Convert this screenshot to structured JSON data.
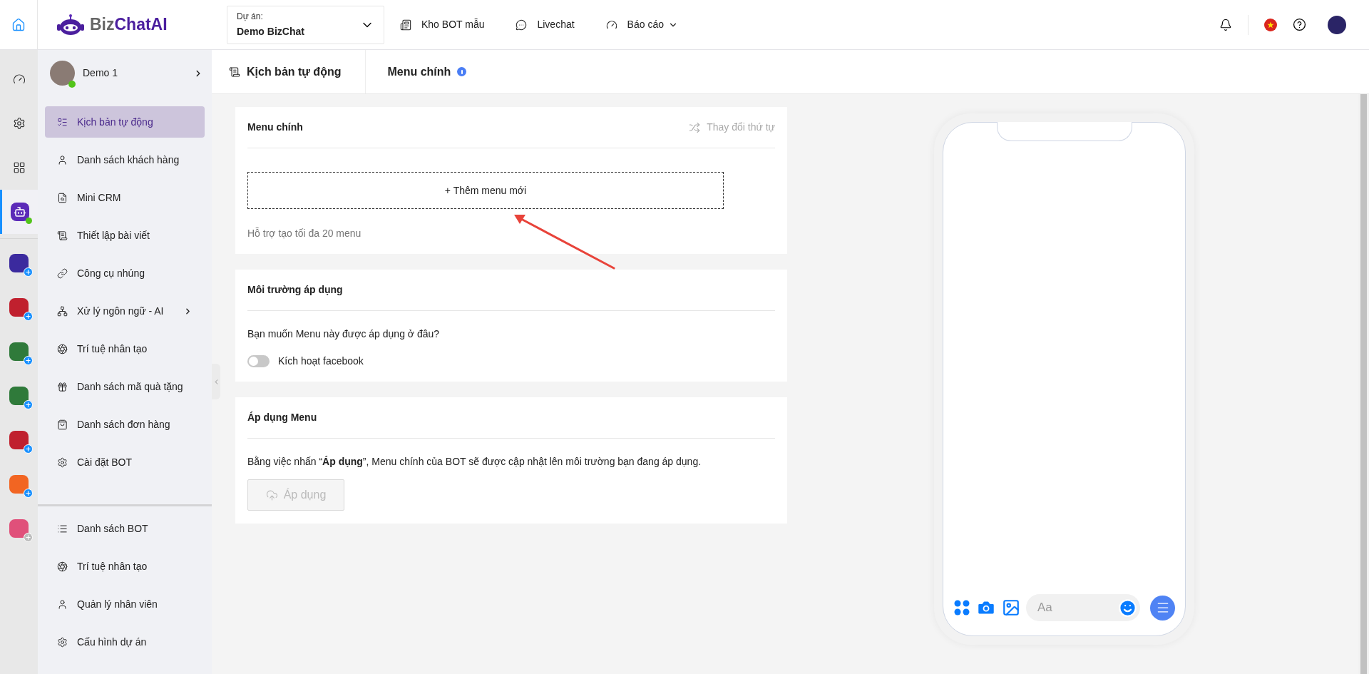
{
  "topbar": {
    "logo": {
      "prefix": "Biz",
      "name": "ChatAI"
    },
    "project": {
      "label": "Dự án:",
      "value": "Demo BizChat"
    },
    "nav": [
      {
        "label": "Kho BOT mẫu",
        "dropdown": false
      },
      {
        "label": "Livechat",
        "dropdown": false
      },
      {
        "label": "Báo cáo",
        "dropdown": true
      }
    ]
  },
  "rail": {
    "tools": [
      {
        "selected": false
      },
      {
        "selected": false
      },
      {
        "selected": false
      },
      {
        "selected": true,
        "online": true
      }
    ],
    "apps": [
      {
        "color": "#3b2a9e",
        "badge_active": true
      },
      {
        "color": "#c0202e",
        "badge_active": true
      },
      {
        "color": "#2f7a3a",
        "badge_active": true
      },
      {
        "color": "#2f7a3a",
        "badge_active": true
      },
      {
        "color": "#c0202e",
        "badge_active": true
      },
      {
        "color": "#f26522",
        "badge_active": true
      },
      {
        "color": "#e0507a",
        "badge_active": false
      }
    ]
  },
  "sidebar": {
    "account": {
      "name": "Demo 1",
      "online": true
    },
    "items": [
      {
        "label": "Kịch bản tự động",
        "selected": true,
        "submenu": false
      },
      {
        "label": "Danh sách khách hàng",
        "selected": false,
        "submenu": false
      },
      {
        "label": "Mini CRM",
        "selected": false,
        "submenu": false
      },
      {
        "label": "Thiết lập bài viết",
        "selected": false,
        "submenu": false
      },
      {
        "label": "Công cụ nhúng",
        "selected": false,
        "submenu": false
      },
      {
        "label": "Xử lý ngôn ngữ - AI",
        "selected": false,
        "submenu": true
      },
      {
        "label": "Trí tuệ nhân tạo",
        "selected": false,
        "submenu": false
      },
      {
        "label": "Danh sách mã quà tặng",
        "selected": false,
        "submenu": false
      },
      {
        "label": "Danh sách đơn hàng",
        "selected": false,
        "submenu": false
      },
      {
        "label": "Cài đặt BOT",
        "selected": false,
        "submenu": false
      }
    ],
    "bottom_items": [
      {
        "label": "Danh sách BOT"
      },
      {
        "label": "Trí tuệ nhân tạo"
      },
      {
        "label": "Quản lý nhân viên"
      },
      {
        "label": "Cấu hình dự án"
      }
    ]
  },
  "breadcrumb": [
    "Kịch bản tự động",
    "Menu chính"
  ],
  "menu_card": {
    "title": "Menu chính",
    "reorder": "Thay đổi thứ tự",
    "add_button": "+ Thêm menu mới",
    "hint": "Hỗ trợ tạo tối đa 20 menu"
  },
  "environment_card": {
    "title": "Môi trường áp dụng",
    "question": "Bạn muốn Menu này được áp dụng ở đâu?",
    "toggle": {
      "label": "Kích hoạt facebook",
      "on": false
    }
  },
  "apply_card": {
    "title": "Áp dụng Menu",
    "description": "Bằng việc nhấn “**Áp dụng**”, Menu chính của BOT sẽ được cập nhật lên môi trường bạn đang áp dụng.",
    "button": {
      "label": "Áp dụng",
      "disabled": true
    }
  },
  "phone_preview": {
    "composer_placeholder": "Aa"
  }
}
